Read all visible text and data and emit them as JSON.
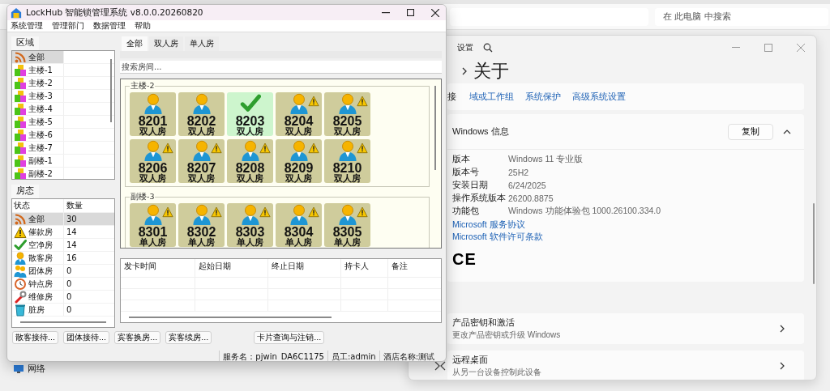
{
  "explorer": {
    "search": {
      "placeholder": "在 此电脑 中搜索"
    },
    "nav_items": [
      {
        "label": "网络"
      }
    ]
  },
  "settings": {
    "title": "设置",
    "breadcrumb": "关于",
    "related_links": [
      {
        "label": "接",
        "kind": "plain"
      },
      {
        "label": "域或工作组",
        "kind": "link"
      },
      {
        "label": "系统保护",
        "kind": "link"
      },
      {
        "label": "高级系统设置",
        "kind": "link"
      }
    ],
    "windows_info": {
      "title": "Windows 信息",
      "copy_button": "复制",
      "expanded": true,
      "rows": [
        {
          "label": "版本",
          "value": "Windows 11 专业版"
        },
        {
          "label": "版本号",
          "value": "25H2"
        },
        {
          "label": "安装日期",
          "value": "6/24/2025"
        },
        {
          "label": "操作系统版本",
          "value": "26200.8875"
        },
        {
          "label": "功能包",
          "value": "Windows 功能体验包 1000.26100.334.0"
        }
      ],
      "links": [
        "Microsoft 服务协议",
        "Microsoft 软件许可条款"
      ],
      "mark": "CE"
    },
    "rows": [
      {
        "title": "产品密钥和激活",
        "subtitle": "更改产品密钥或升级 Windows"
      },
      {
        "title": "远程桌面",
        "subtitle": "从另一台设备控制此设备"
      }
    ]
  },
  "lockhub": {
    "title": "LockHub 智能锁管理系统 v8.0.0.20260820",
    "menu": [
      "系统管理",
      "管理部门",
      "数据管理",
      "帮助"
    ],
    "regions": {
      "tab": "区域",
      "items": [
        {
          "label": "全部",
          "kind": "all",
          "selected": true
        },
        {
          "label": "主楼-1",
          "kind": "building",
          "selected": false
        },
        {
          "label": "主楼-2",
          "kind": "building",
          "selected": false
        },
        {
          "label": "主楼-3",
          "kind": "building",
          "selected": false
        },
        {
          "label": "主楼-4",
          "kind": "building",
          "selected": false
        },
        {
          "label": "主楼-5",
          "kind": "building",
          "selected": false
        },
        {
          "label": "主楼-6",
          "kind": "building",
          "selected": false
        },
        {
          "label": "主楼-7",
          "kind": "building",
          "selected": false
        },
        {
          "label": "副楼-1",
          "kind": "building",
          "selected": false
        },
        {
          "label": "副楼-2",
          "kind": "building",
          "selected": false
        }
      ]
    },
    "room_status": {
      "tab": "房态",
      "columns": [
        "状态",
        "数量"
      ],
      "rows": [
        {
          "label": "全部",
          "count": "30",
          "kind": "all",
          "selected": true
        },
        {
          "label": "催款房",
          "count": "14",
          "kind": "arrears",
          "selected": false
        },
        {
          "label": "空净房",
          "count": "14",
          "kind": "vacant",
          "selected": false
        },
        {
          "label": "散客房",
          "count": "16",
          "kind": "guest",
          "selected": false
        },
        {
          "label": "团体房",
          "count": "0",
          "kind": "group",
          "selected": false
        },
        {
          "label": "钟点房",
          "count": "0",
          "kind": "hourly",
          "selected": false
        },
        {
          "label": "维修房",
          "count": "0",
          "kind": "repair",
          "selected": false
        },
        {
          "label": "脏房",
          "count": "0",
          "kind": "dirty",
          "selected": false
        }
      ]
    },
    "room_tabs": [
      {
        "label": "全部",
        "selected": true
      },
      {
        "label": "双人房",
        "selected": false
      },
      {
        "label": "单人房",
        "selected": false
      }
    ],
    "search": {
      "placeholder": "搜索房间..."
    },
    "room_groups": [
      {
        "name": "主楼-2",
        "rooms": [
          {
            "number": "8201",
            "type": "双人房",
            "kind": "occupied",
            "alert": false
          },
          {
            "number": "8202",
            "type": "双人房",
            "kind": "occupied",
            "alert": false
          },
          {
            "number": "8203",
            "type": "双人房",
            "kind": "vacant",
            "alert": false
          },
          {
            "number": "8204",
            "type": "双人房",
            "kind": "occupied",
            "alert": true
          },
          {
            "number": "8205",
            "type": "双人房",
            "kind": "occupied",
            "alert": true
          },
          {
            "number": "8206",
            "type": "双人房",
            "kind": "occupied",
            "alert": true
          },
          {
            "number": "8207",
            "type": "双人房",
            "kind": "occupied",
            "alert": true
          },
          {
            "number": "8208",
            "type": "双人房",
            "kind": "occupied",
            "alert": true
          },
          {
            "number": "8209",
            "type": "双人房",
            "kind": "occupied",
            "alert": true
          },
          {
            "number": "8210",
            "type": "双人房",
            "kind": "occupied",
            "alert": true
          }
        ]
      },
      {
        "name": "副楼-3",
        "rooms": [
          {
            "number": "8301",
            "type": "单人房",
            "kind": "occupied",
            "alert": true
          },
          {
            "number": "8302",
            "type": "单人房",
            "kind": "occupied",
            "alert": true
          },
          {
            "number": "8303",
            "type": "单人房",
            "kind": "occupied",
            "alert": true
          },
          {
            "number": "8304",
            "type": "单人房",
            "kind": "occupied",
            "alert": true
          },
          {
            "number": "8305",
            "type": "单人房",
            "kind": "occupied",
            "alert": true
          }
        ]
      }
    ],
    "card_table": {
      "columns": [
        "发卡时间",
        "起始日期",
        "终止日期",
        "持卡人",
        "备注"
      ]
    },
    "buttons": [
      "散客接待...",
      "团体接待...",
      "宾客换房...",
      "宾客续房...",
      "卡片查询与注销..."
    ],
    "status_bar": [
      "服务名：pjwin_DA6C1175",
      "员工:admin",
      "酒店名称:测试"
    ]
  }
}
